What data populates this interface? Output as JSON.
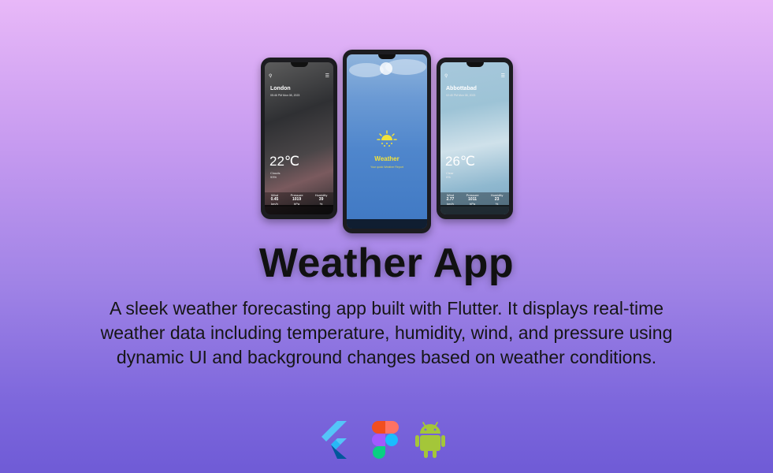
{
  "title": "Weather App",
  "description": "A sleek weather forecasting app built with Flutter. It displays real-time weather data including temperature, humidity, wind, and pressure using dynamic UI and background changes based on weather conditions.",
  "phones": {
    "left": {
      "city": "London",
      "date": "05:46 PM Mon 08, 2023",
      "temperature": "22℃",
      "condition": "Clouds",
      "condition_sub": "93%",
      "stats": [
        {
          "label": "Wind",
          "value": "0.45",
          "unit": "km/h"
        },
        {
          "label": "Pressure",
          "value": "1019",
          "unit": "hPa"
        },
        {
          "label": "Humidity",
          "value": "39",
          "unit": "%"
        }
      ]
    },
    "middle": {
      "app_name": "Weather",
      "tagline": "Your quick Weather Report"
    },
    "right": {
      "city": "Abbottabad",
      "date": "02:45 PM Mon 08, 2023",
      "temperature": "26℃",
      "condition": "Clear",
      "condition_sub": "0%",
      "stats": [
        {
          "label": "Wind",
          "value": "2.77",
          "unit": "km/h"
        },
        {
          "label": "Pressure",
          "value": "1011",
          "unit": "hPa"
        },
        {
          "label": "Humidity",
          "value": "23",
          "unit": "%"
        }
      ]
    }
  },
  "tech_icons": [
    "flutter-icon",
    "figma-icon",
    "android-icon"
  ],
  "colors": {
    "flutter_light": "#54c5f8",
    "flutter_dark": "#01579b",
    "android": "#a4c639"
  }
}
